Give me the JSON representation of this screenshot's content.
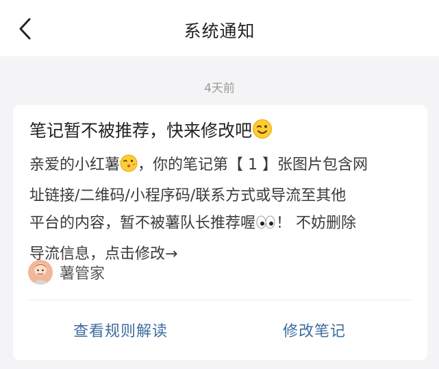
{
  "header": {
    "title": "系统通知",
    "back_icon": "chevron-left-icon"
  },
  "timestamp": "4天前",
  "notification": {
    "title": "笔记暂不被推荐，快来修改吧",
    "title_emoji": "winking-face-icon",
    "body_line1_a": "亲爱的小红薯",
    "body_emoji1": "kissing-face-icon",
    "body_line1_b": "，你的笔记第【 1 】张图片包含网",
    "body_line2": "址链接/二维码/小程序码/联系方式或导流至其他",
    "body_line3_a": "平台的内容，暂不被薯队长推荐喔",
    "body_emoji2": "eyes-icon",
    "body_line3_b": "！ 不妨删除",
    "body_line4": "导流信息，点击修改→",
    "sender": {
      "name": "薯管家",
      "avatar_icon": "avatar-icon"
    },
    "actions": {
      "view_rules": "查看规则解读",
      "edit_note": "修改笔记"
    }
  },
  "colors": {
    "link": "#3d6c9f",
    "background": "#f4f4f6",
    "card": "#ffffff"
  }
}
